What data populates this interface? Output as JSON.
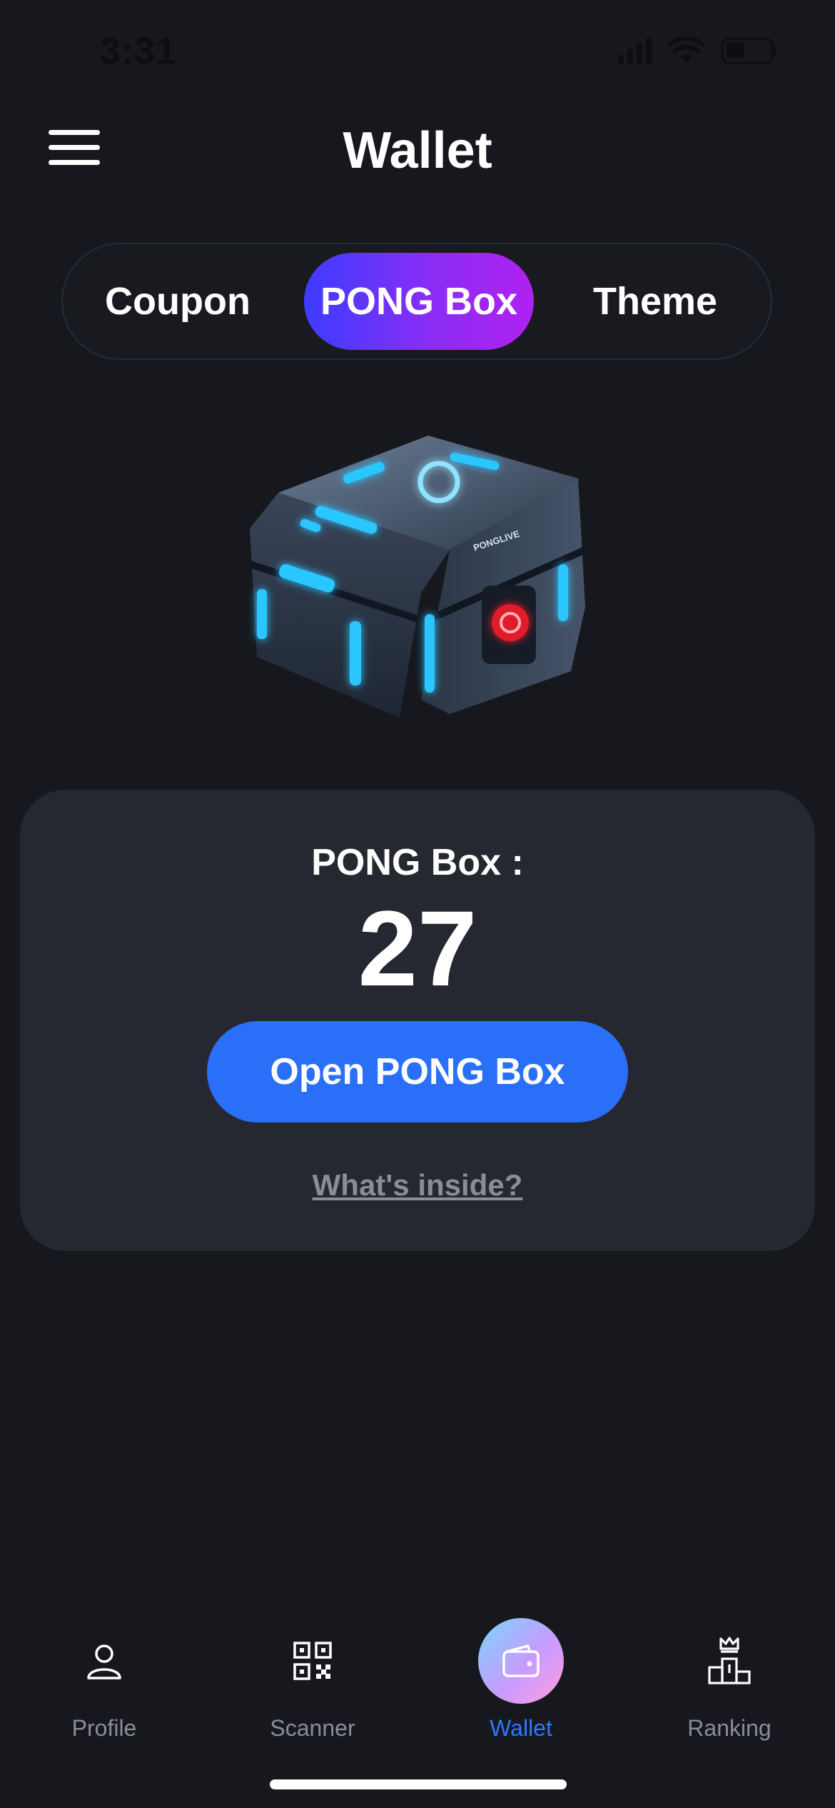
{
  "status_bar": {
    "time": "3:31",
    "battery_percent": 35
  },
  "header": {
    "title": "Wallet",
    "menu_icon": "hamburger-menu-icon"
  },
  "tabs": [
    {
      "label": "Coupon",
      "active": false
    },
    {
      "label": "PONG Box",
      "active": true
    },
    {
      "label": "Theme",
      "active": false
    }
  ],
  "box_image": {
    "brand_text": "PONGLIVE"
  },
  "card": {
    "count_label": "PONG Box :",
    "count_value": "27",
    "open_button": "Open PONG Box",
    "inside_link": "What's inside?"
  },
  "bottom_nav": [
    {
      "label": "Profile",
      "icon": "person-icon",
      "active": false
    },
    {
      "label": "Scanner",
      "icon": "qr-code-icon",
      "active": false
    },
    {
      "label": "Wallet",
      "icon": "wallet-icon",
      "active": true
    },
    {
      "label": "Ranking",
      "icon": "podium-crown-icon",
      "active": false
    }
  ],
  "colors": {
    "background": "#17181e",
    "card": "#262831",
    "primary_button": "#2a6ff8",
    "active_nav_label": "#2a79ff",
    "tab_gradient_start": "#3d3cff",
    "tab_gradient_end": "#b021f0"
  }
}
